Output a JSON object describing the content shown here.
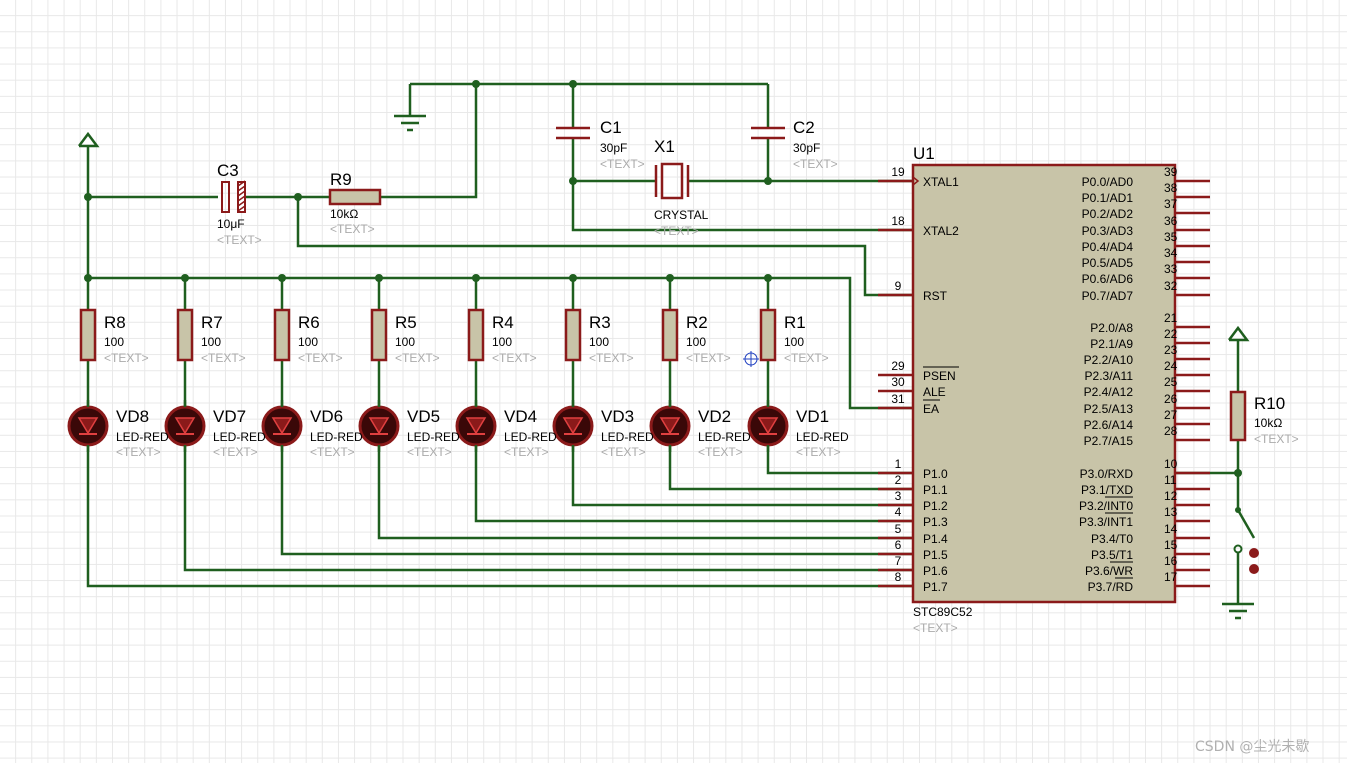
{
  "colors": {
    "wire": "#1f5f1f",
    "component": "#8b1a1a",
    "ic_fill": "#c8c4a8",
    "led_fill": "#3a0808"
  },
  "parts": {
    "C1": {
      "ref": "C1",
      "value": "30pF",
      "text": "<TEXT>"
    },
    "C2": {
      "ref": "C2",
      "value": "30pF",
      "text": "<TEXT>"
    },
    "C3": {
      "ref": "C3",
      "value": "10μF",
      "text": "<TEXT>"
    },
    "X1": {
      "ref": "X1",
      "value": "CRYSTAL",
      "text": "<TEXT>"
    },
    "R9": {
      "ref": "R9",
      "value": "10kΩ",
      "text": "<TEXT>"
    },
    "R10": {
      "ref": "R10",
      "value": "10kΩ",
      "text": "<TEXT>"
    },
    "U1": {
      "ref": "U1",
      "value": "STC89C52",
      "text": "<TEXT>"
    }
  },
  "resistors": [
    {
      "ref": "R8",
      "value": "100",
      "text": "<TEXT>"
    },
    {
      "ref": "R7",
      "value": "100",
      "text": "<TEXT>"
    },
    {
      "ref": "R6",
      "value": "100",
      "text": "<TEXT>"
    },
    {
      "ref": "R5",
      "value": "100",
      "text": "<TEXT>"
    },
    {
      "ref": "R4",
      "value": "100",
      "text": "<TEXT>"
    },
    {
      "ref": "R3",
      "value": "100",
      "text": "<TEXT>"
    },
    {
      "ref": "R2",
      "value": "100",
      "text": "<TEXT>"
    },
    {
      "ref": "R1",
      "value": "100",
      "text": "<TEXT>"
    }
  ],
  "leds": [
    {
      "ref": "VD8",
      "value": "LED-RED",
      "text": "<TEXT>"
    },
    {
      "ref": "VD7",
      "value": "LED-RED",
      "text": "<TEXT>"
    },
    {
      "ref": "VD6",
      "value": "LED-RED",
      "text": "<TEXT>"
    },
    {
      "ref": "VD5",
      "value": "LED-RED",
      "text": "<TEXT>"
    },
    {
      "ref": "VD4",
      "value": "LED-RED",
      "text": "<TEXT>"
    },
    {
      "ref": "VD3",
      "value": "LED-RED",
      "text": "<TEXT>"
    },
    {
      "ref": "VD2",
      "value": "LED-RED",
      "text": "<TEXT>"
    },
    {
      "ref": "VD1",
      "value": "LED-RED",
      "text": "<TEXT>"
    }
  ],
  "u1_left_pins": [
    {
      "num": "19",
      "name": "XTAL1"
    },
    {
      "num": "18",
      "name": "XTAL2"
    },
    {
      "num": "9",
      "name": "RST"
    },
    {
      "num": "29",
      "name": "PSEN"
    },
    {
      "num": "30",
      "name": "ALE"
    },
    {
      "num": "31",
      "name": "EA"
    },
    {
      "num": "1",
      "name": "P1.0"
    },
    {
      "num": "2",
      "name": "P1.1"
    },
    {
      "num": "3",
      "name": "P1.2"
    },
    {
      "num": "4",
      "name": "P1.3"
    },
    {
      "num": "5",
      "name": "P1.4"
    },
    {
      "num": "6",
      "name": "P1.5"
    },
    {
      "num": "7",
      "name": "P1.6"
    },
    {
      "num": "8",
      "name": "P1.7"
    }
  ],
  "u1_right_pins": [
    {
      "num": "39",
      "name": "P0.0/AD0"
    },
    {
      "num": "38",
      "name": "P0.1/AD1"
    },
    {
      "num": "37",
      "name": "P0.2/AD2"
    },
    {
      "num": "36",
      "name": "P0.3/AD3"
    },
    {
      "num": "35",
      "name": "P0.4/AD4"
    },
    {
      "num": "34",
      "name": "P0.5/AD5"
    },
    {
      "num": "33",
      "name": "P0.6/AD6"
    },
    {
      "num": "32",
      "name": "P0.7/AD7"
    },
    {
      "num": "21",
      "name": "P2.0/A8"
    },
    {
      "num": "22",
      "name": "P2.1/A9"
    },
    {
      "num": "23",
      "name": "P2.2/A10"
    },
    {
      "num": "24",
      "name": "P2.3/A11"
    },
    {
      "num": "25",
      "name": "P2.4/A12"
    },
    {
      "num": "26",
      "name": "P2.5/A13"
    },
    {
      "num": "27",
      "name": "P2.6/A14"
    },
    {
      "num": "28",
      "name": "P2.7/A15"
    },
    {
      "num": "10",
      "name": "P3.0/RXD"
    },
    {
      "num": "11",
      "name": "P3.1/TXD"
    },
    {
      "num": "12",
      "name": "P3.2/INT0"
    },
    {
      "num": "13",
      "name": "P3.3/INT1"
    },
    {
      "num": "14",
      "name": "P3.4/T0"
    },
    {
      "num": "15",
      "name": "P3.5/T1"
    },
    {
      "num": "16",
      "name": "P3.6/WR"
    },
    {
      "num": "17",
      "name": "P3.7/RD"
    }
  ],
  "watermark": "CSDN @尘光未歇"
}
